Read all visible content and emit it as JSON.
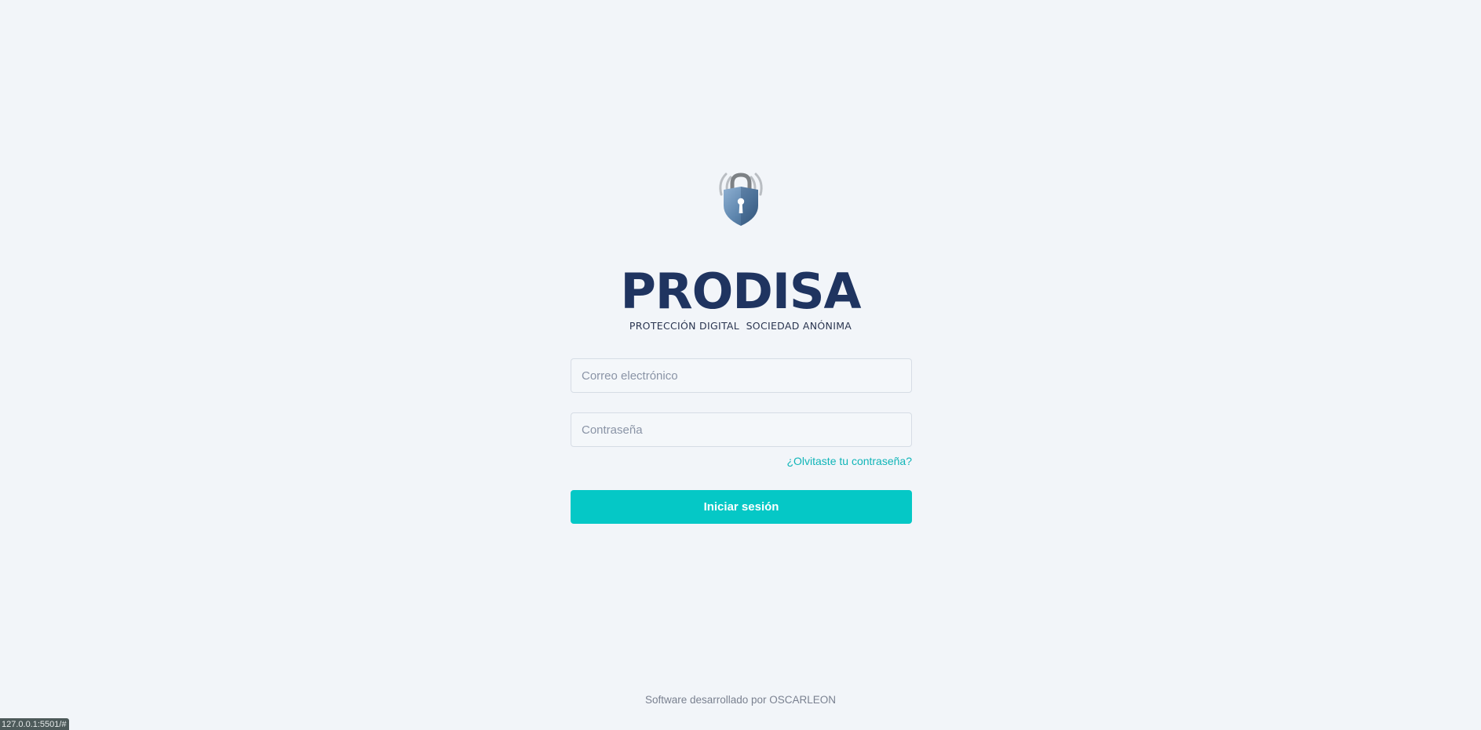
{
  "brand": {
    "logo_icon": "shield-lock-wireless-icon",
    "name": "PRODISA",
    "tagline": "PROTECCIÓN DIGITAL  SOCIEDAD ANÓNIMA"
  },
  "login_form": {
    "email_placeholder": "Correo electrónico",
    "email_value": "",
    "password_placeholder": "Contraseña",
    "password_value": "",
    "forgot_link": "¿Olvitaste tu contraseña?",
    "submit_label": "Iniciar sesión"
  },
  "footer": {
    "credit": "Software desarrollado por OSCARLEON"
  },
  "status_bar": {
    "url": "127.0.0.1:5501/#"
  },
  "colors": {
    "background": "#f2f5f9",
    "brand_navy": "#1f3460",
    "accent_teal": "#05c8c6",
    "link_teal": "#10b5b8"
  }
}
